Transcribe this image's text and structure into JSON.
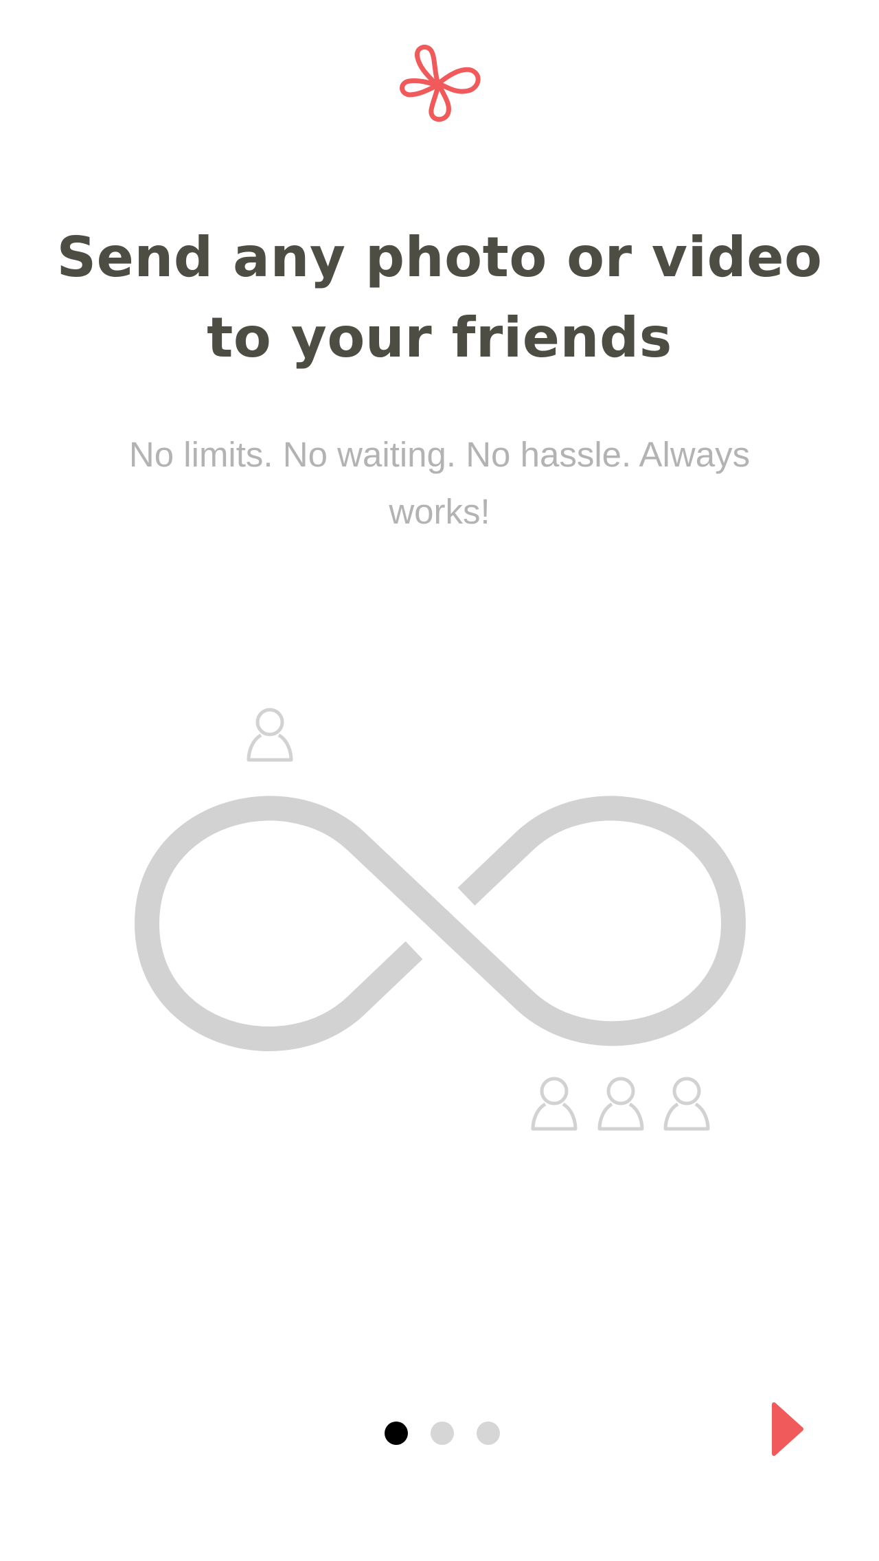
{
  "header": {
    "logo_icon": "clover-knot-icon",
    "accent_color": "#f05a5a"
  },
  "main": {
    "headline": "Send any photo or video to your friends",
    "subtitle": "No limits. No waiting. No hassle. Always works!"
  },
  "illustration": {
    "icons": [
      "infinity-icon",
      "person-icon",
      "person-icon",
      "person-icon",
      "person-icon"
    ],
    "stroke_color": "#d2d2d2"
  },
  "pager": {
    "total": 3,
    "current": 1,
    "active_color": "#000000",
    "inactive_color": "#d6d6d6"
  },
  "next_button": {
    "icon": "play-arrow-icon",
    "color": "#f05a5a"
  }
}
